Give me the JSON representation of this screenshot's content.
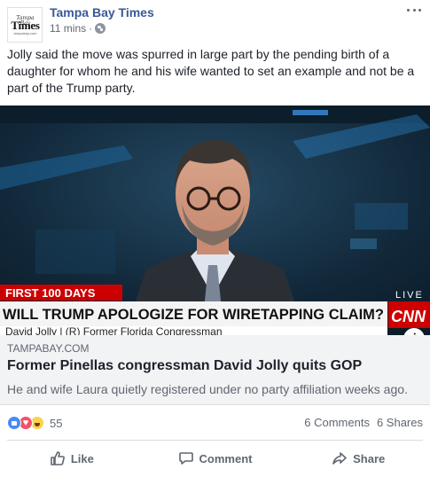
{
  "post": {
    "page_name": "Tampa Bay Times",
    "time": "11 mins",
    "separator": "·",
    "avatar": {
      "top": "Tampa Bay",
      "main": "Times",
      "sub": "tampabay.com"
    },
    "text": "Jolly said the move was spurred in large part by the pending birth of a daughter for whom he and his wife wanted to set an example and not be a part of the Trump party.",
    "icons": {
      "privacy": "globe-icon",
      "menu": "more-icon"
    }
  },
  "image": {
    "banner_top": "FIRST 100 DAYS",
    "headline": "WILL TRUMP APOLOGIZE FOR WIRETAPPING CLAIM?",
    "lower_third": "David Jolly  |  (R) Former Florida Congressman",
    "live": "LIVE",
    "network": "CNN",
    "info": "i"
  },
  "link": {
    "domain": "TAMPABAY.COM",
    "title": "Former Pinellas congressman David Jolly quits GOP",
    "description": "He and wife Laura quietly registered under no party affiliation weeks ago."
  },
  "stats": {
    "reaction_count": "55",
    "comments": "6 Comments",
    "shares": "6 Shares",
    "reaction_icons": [
      "like-react-icon",
      "love-react-icon",
      "haha-react-icon"
    ]
  },
  "actions": {
    "like": "Like",
    "comment": "Comment",
    "share": "Share"
  },
  "colors": {
    "page_name": "#385898",
    "cnn_red": "#cc0000",
    "link_box_bg": "#f2f3f5"
  }
}
